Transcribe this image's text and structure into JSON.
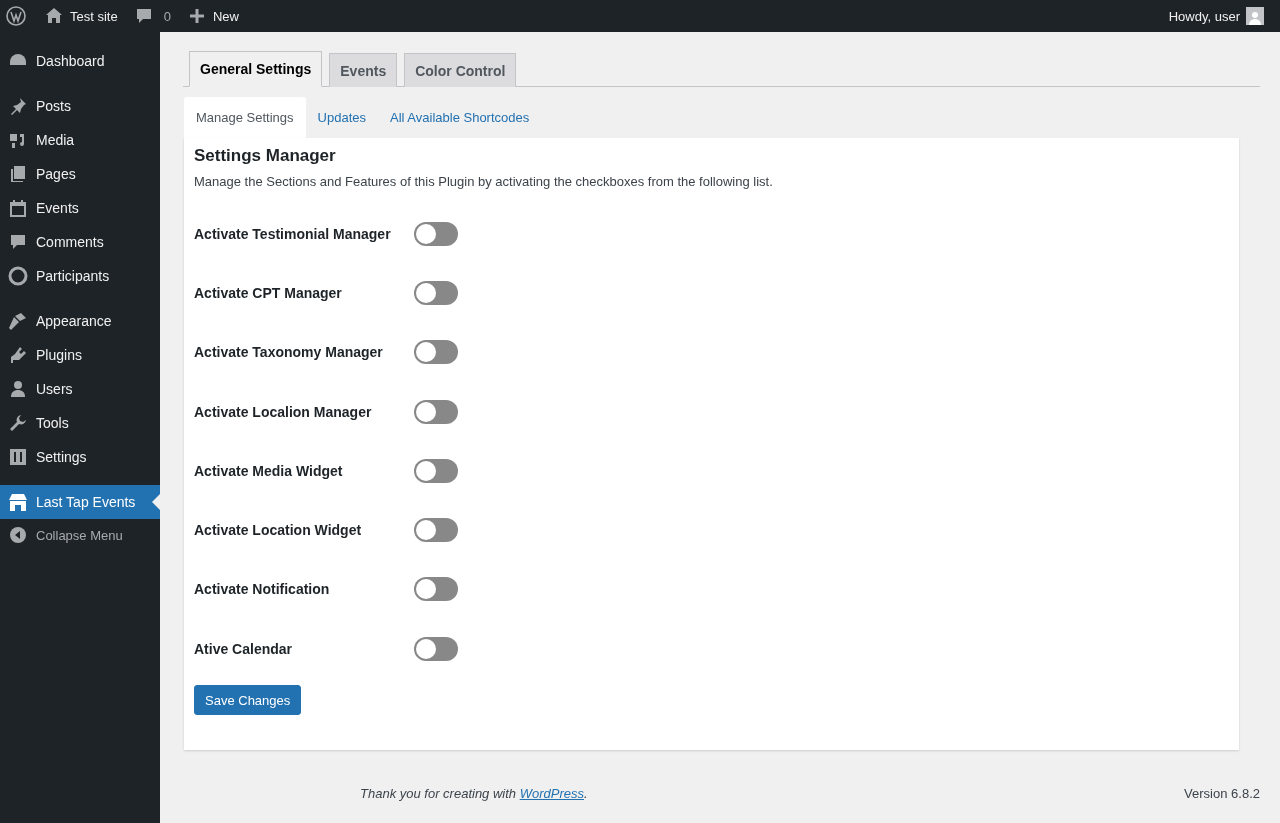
{
  "admin_bar": {
    "site": "Test site",
    "comments": "0",
    "new": "New",
    "greeting": "Howdy, user"
  },
  "sidebar": {
    "groups": [
      [
        {
          "label": "Dashboard",
          "selected": false
        }
      ],
      [
        {
          "label": "Posts",
          "selected": false
        },
        {
          "label": "Media",
          "selected": false
        },
        {
          "label": "Pages",
          "selected": false
        },
        {
          "label": "Events",
          "selected": false
        },
        {
          "label": "Comments",
          "selected": false
        },
        {
          "label": "Participants",
          "selected": false
        }
      ],
      [
        {
          "label": "Appearance",
          "selected": false
        },
        {
          "label": "Plugins",
          "selected": false
        },
        {
          "label": "Users",
          "selected": false
        },
        {
          "label": "Tools",
          "selected": false
        },
        {
          "label": "Settings",
          "selected": false
        }
      ],
      [
        {
          "label": "Last Tap Events",
          "selected": true
        }
      ]
    ],
    "collapse": "Collapse Menu"
  },
  "tabs": [
    {
      "label": "General Settings",
      "selected": true
    },
    {
      "label": "Events",
      "selected": false
    },
    {
      "label": "Color Control",
      "selected": false
    }
  ],
  "subtabs": [
    {
      "label": "Manage Settings",
      "selected": true
    },
    {
      "label": "Updates",
      "selected": false
    },
    {
      "label": "All Available Shortcodes",
      "selected": false
    }
  ],
  "panel": {
    "title": "Settings Manager",
    "description": "Manage the Sections and Features of this Plugin by activating the checkboxes from the following list.",
    "toggles": [
      {
        "label": "Activate Testimonial Manager",
        "on": false
      },
      {
        "label": "Activate CPT Manager",
        "on": false
      },
      {
        "label": "Activate Taxonomy Manager",
        "on": false
      },
      {
        "label": "Activate Localion Manager",
        "on": false
      },
      {
        "label": "Activate Media Widget",
        "on": false
      },
      {
        "label": "Activate Location Widget",
        "on": false
      },
      {
        "label": "Activate Notification",
        "on": false
      },
      {
        "label": "Ative Calendar",
        "on": false
      }
    ],
    "save_button": "Save Changes"
  },
  "footer": {
    "thanks": "Thank you for creating with ",
    "link": "WordPress",
    "after": ".",
    "version": "Version 6.8.2"
  }
}
